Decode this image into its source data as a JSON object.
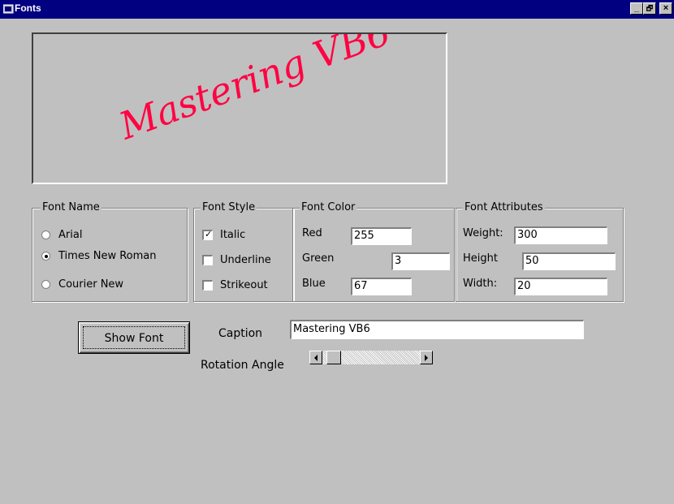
{
  "window": {
    "title": "Fonts",
    "minimize_label": "_",
    "restore_label": "🗗",
    "close_label": "×"
  },
  "preview": {
    "text": "Mastering VB6",
    "color": "#ff0343",
    "rotation_deg": 20
  },
  "font_name": {
    "title": "Font Name",
    "options": [
      {
        "label": "Arial",
        "checked": false
      },
      {
        "label": "Times New Roman",
        "checked": true
      },
      {
        "label": "Courier New",
        "checked": false
      }
    ]
  },
  "font_style": {
    "title": "Font Style",
    "options": [
      {
        "label": "Italic",
        "checked": true,
        "mark": "✓"
      },
      {
        "label": "Underline",
        "checked": false,
        "mark": ""
      },
      {
        "label": "Strikeout",
        "checked": false,
        "mark": ""
      }
    ]
  },
  "font_color": {
    "title": "Font Color",
    "red": {
      "label": "Red",
      "value": "255"
    },
    "green": {
      "label": "Green",
      "value": "3"
    },
    "blue": {
      "label": "Blue",
      "value": "67"
    }
  },
  "font_attributes": {
    "title": "Font Attributes",
    "weight": {
      "label": "Weight:",
      "value": "300"
    },
    "height": {
      "label": "Height",
      "value": "50"
    },
    "width": {
      "label": "Width:",
      "value": "20"
    }
  },
  "show_font_button": "Show Font",
  "caption": {
    "label": "Caption",
    "value": "Mastering VB6"
  },
  "rotation": {
    "label": "Rotation Angle",
    "value_fraction": 0.05
  },
  "icons": [
    "window-app-icon",
    "scroll-left-arrow-icon",
    "scroll-right-arrow-icon"
  ]
}
